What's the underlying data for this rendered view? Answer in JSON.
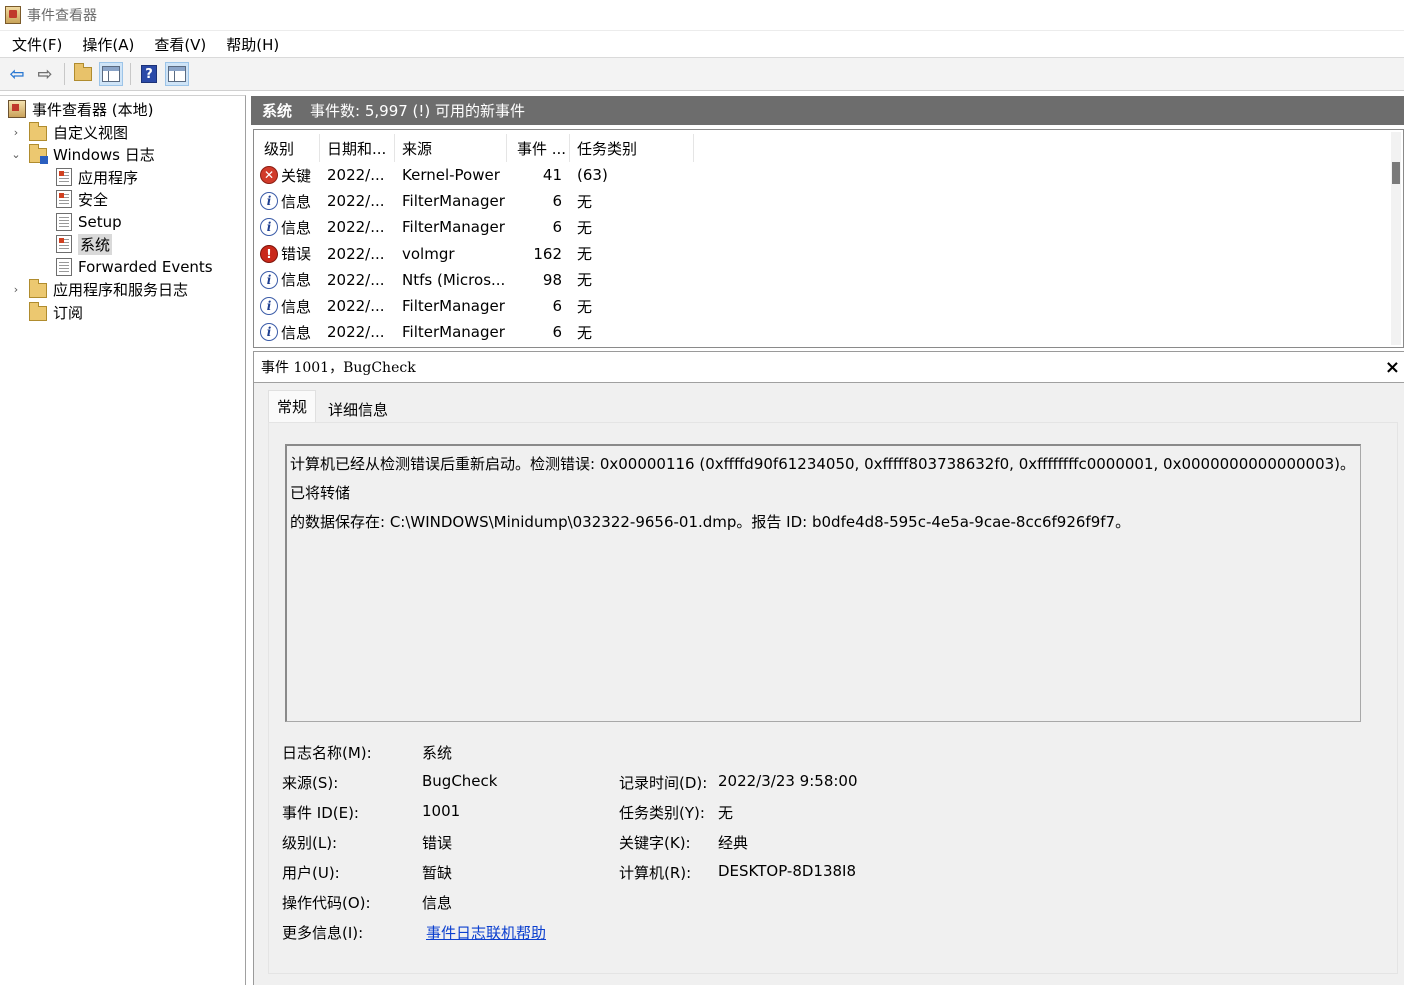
{
  "window": {
    "title": "事件查看器"
  },
  "menu": [
    "文件(F)",
    "操作(A)",
    "查看(V)",
    "帮助(H)"
  ],
  "toolbar": {
    "buttons": [
      "back-icon",
      "forward-icon",
      "up-folder-icon",
      "show-hide-console-tree-icon",
      "help-icon",
      "show-hide-action-pane-icon"
    ]
  },
  "tree": {
    "root": "事件查看器 (本地)",
    "custom_views": "自定义视图",
    "windows_logs": "Windows 日志",
    "app": "应用程序",
    "security": "安全",
    "setup": "Setup",
    "system": "系统",
    "forwarded": "Forwarded Events",
    "app_services": "应用程序和服务日志",
    "subscriptions": "订阅"
  },
  "right_header": {
    "title": "系统",
    "subtitle": "事件数: 5,997 (!) 可用的新事件"
  },
  "list": {
    "columns": [
      "级别",
      "日期和...",
      "来源",
      "事件 ...",
      "任务类别"
    ],
    "rows": [
      {
        "icon": "critical",
        "icon_glyph": "✕",
        "level": "关键",
        "date": "2022/...",
        "source": "Kernel-Power",
        "id": "41",
        "task": "(63)"
      },
      {
        "icon": "info",
        "icon_glyph": "i",
        "level": "信息",
        "date": "2022/...",
        "source": "FilterManager",
        "id": "6",
        "task": "无"
      },
      {
        "icon": "info",
        "icon_glyph": "i",
        "level": "信息",
        "date": "2022/...",
        "source": "FilterManager",
        "id": "6",
        "task": "无"
      },
      {
        "icon": "error",
        "icon_glyph": "!",
        "level": "错误",
        "date": "2022/...",
        "source": "volmgr",
        "id": "162",
        "task": "无"
      },
      {
        "icon": "info",
        "icon_glyph": "i",
        "level": "信息",
        "date": "2022/...",
        "source": "Ntfs (Micros...",
        "id": "98",
        "task": "无"
      },
      {
        "icon": "info",
        "icon_glyph": "i",
        "level": "信息",
        "date": "2022/...",
        "source": "FilterManager",
        "id": "6",
        "task": "无"
      },
      {
        "icon": "info",
        "icon_glyph": "i",
        "level": "信息",
        "date": "2022/...",
        "source": "FilterManager",
        "id": "6",
        "task": "无"
      }
    ]
  },
  "detail": {
    "title": "事件 1001，BugCheck",
    "close": "×",
    "tabs": [
      "常规",
      "详细信息"
    ],
    "description_line1": "计算机已经从检测错误后重新启动。检测错误: 0x00000116 (0xffffd90f61234050, 0xfffff803738632f0, 0xffffffffc0000001, 0x0000000000000003)。已将转储",
    "description_line2": "的数据保存在: C:\\WINDOWS\\Minidump\\032322-9656-01.dmp。报告 ID: b0dfe4d8-595c-4e5a-9cae-8cc6f926f9f7。",
    "fields": {
      "log_name_label": "日志名称(M):",
      "log_name": "系统",
      "source_label": "来源(S):",
      "source": "BugCheck",
      "event_id_label": "事件 ID(E):",
      "event_id": "1001",
      "level_label": "级别(L):",
      "level": "错误",
      "user_label": "用户(U):",
      "user": "暂缺",
      "opcode_label": "操作代码(O):",
      "opcode": "信息",
      "more_info_label": "更多信息(I):",
      "more_info": "事件日志联机帮助",
      "logged_label": "记录时间(D):",
      "logged": "2022/3/23 9:58:00",
      "task_label": "任务类别(Y):",
      "task": "无",
      "keywords_label": "关键字(K):",
      "keywords": "经典",
      "computer_label": "计算机(R):",
      "computer": "DESKTOP-8D138I8"
    }
  }
}
